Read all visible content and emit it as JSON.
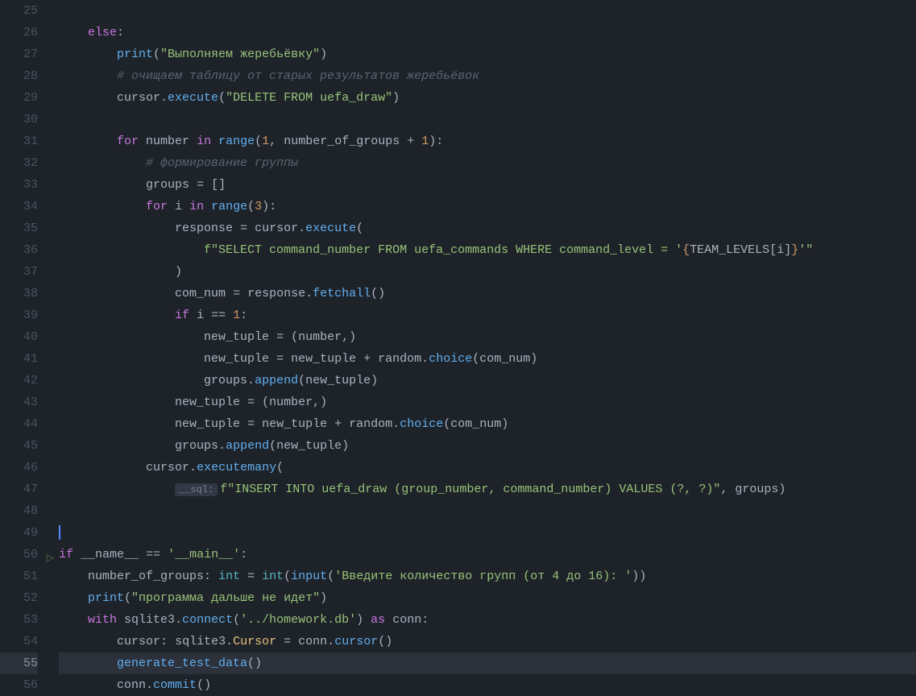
{
  "lines": {
    "25": {
      "num": "25"
    },
    "26": {
      "num": "26",
      "kw_else": "else"
    },
    "27": {
      "num": "27",
      "fn_print": "print",
      "str": "\"Выполняем жеребьёвку\""
    },
    "28": {
      "num": "28",
      "cmt": "# очищаем таблицу от старых результатов жеребьёвок"
    },
    "29": {
      "num": "29",
      "var_cursor": "cursor",
      "fn_execute": "execute",
      "str": "\"DELETE FROM uefa_draw\""
    },
    "30": {
      "num": "30"
    },
    "31": {
      "num": "31",
      "kw_for": "for",
      "var_number": "number",
      "kw_in": "in",
      "fn_range": "range",
      "n1": "1",
      "var_nog": "number_of_groups",
      "plus": "+",
      "n1b": "1"
    },
    "32": {
      "num": "32",
      "cmt": "# формирование группы"
    },
    "33": {
      "num": "33",
      "var_groups": "groups",
      "eq": "="
    },
    "34": {
      "num": "34",
      "kw_for": "for",
      "var_i": "i",
      "kw_in": "in",
      "fn_range": "range",
      "n3": "3"
    },
    "35": {
      "num": "35",
      "var_response": "response",
      "eq": "=",
      "var_cursor": "cursor",
      "fn_execute": "execute"
    },
    "36": {
      "num": "36",
      "f": "f",
      "str_a": "\"SELECT command_number FROM uefa_commands WHERE command_level = '",
      "brace_o": "{",
      "var_tl": "TEAM_LEVELS",
      "var_i": "i",
      "brace_c": "}",
      "str_b": "'\""
    },
    "37": {
      "num": "37"
    },
    "38": {
      "num": "38",
      "var_cn": "com_num",
      "eq": "=",
      "var_response": "response",
      "fn_fetchall": "fetchall"
    },
    "39": {
      "num": "39",
      "kw_if": "if",
      "var_i": "i",
      "eq": "==",
      "n1": "1"
    },
    "40": {
      "num": "40",
      "var_nt": "new_tuple",
      "eq": "=",
      "var_number": "number"
    },
    "41": {
      "num": "41",
      "var_nt": "new_tuple",
      "eq": "=",
      "var_nt2": "new_tuple",
      "plus": "+",
      "var_random": "random",
      "fn_choice": "choice",
      "var_cn": "com_num"
    },
    "42": {
      "num": "42",
      "var_groups": "groups",
      "fn_append": "append",
      "var_nt": "new_tuple"
    },
    "43": {
      "num": "43",
      "var_nt": "new_tuple",
      "eq": "=",
      "var_number": "number"
    },
    "44": {
      "num": "44",
      "var_nt": "new_tuple",
      "eq": "=",
      "var_nt2": "new_tuple",
      "plus": "+",
      "var_random": "random",
      "fn_choice": "choice",
      "var_cn": "com_num"
    },
    "45": {
      "num": "45",
      "var_groups": "groups",
      "fn_append": "append",
      "var_nt": "new_tuple"
    },
    "46": {
      "num": "46",
      "var_cursor": "cursor",
      "fn_em": "executemany"
    },
    "47": {
      "num": "47",
      "hint": "__sql:",
      "f": "f",
      "str": "\"INSERT INTO uefa_draw (group_number, command_number) VALUES (?, ?)\"",
      "var_groups": "groups"
    },
    "48": {
      "num": "48"
    },
    "49": {
      "num": "49"
    },
    "50": {
      "num": "50",
      "kw_if": "if",
      "var_name": "__name__",
      "eq": "==",
      "str": "'__main__'"
    },
    "51": {
      "num": "51",
      "var_nog": "number_of_groups",
      "type_int": "int",
      "eq": "=",
      "fn_int": "int",
      "fn_input": "input",
      "str": "'Введите количество групп (от 4 до 16): '"
    },
    "52": {
      "num": "52",
      "fn_print": "print",
      "str": "\"программа дальше не идет\""
    },
    "53": {
      "num": "53",
      "kw_with": "with",
      "var_sqlite": "sqlite3",
      "fn_connect": "connect",
      "str": "'../homework.db'",
      "kw_as": "as",
      "var_conn": "conn"
    },
    "54": {
      "num": "54",
      "var_cursor": "cursor",
      "var_sqlite": "sqlite3",
      "type_cursor": "Cursor",
      "eq": "=",
      "var_conn": "conn",
      "fn_cursor": "cursor"
    },
    "55": {
      "num": "55",
      "fn_gtd": "generate_test_data"
    },
    "56": {
      "num": "56",
      "var_conn": "conn",
      "fn_commit": "commit"
    }
  }
}
